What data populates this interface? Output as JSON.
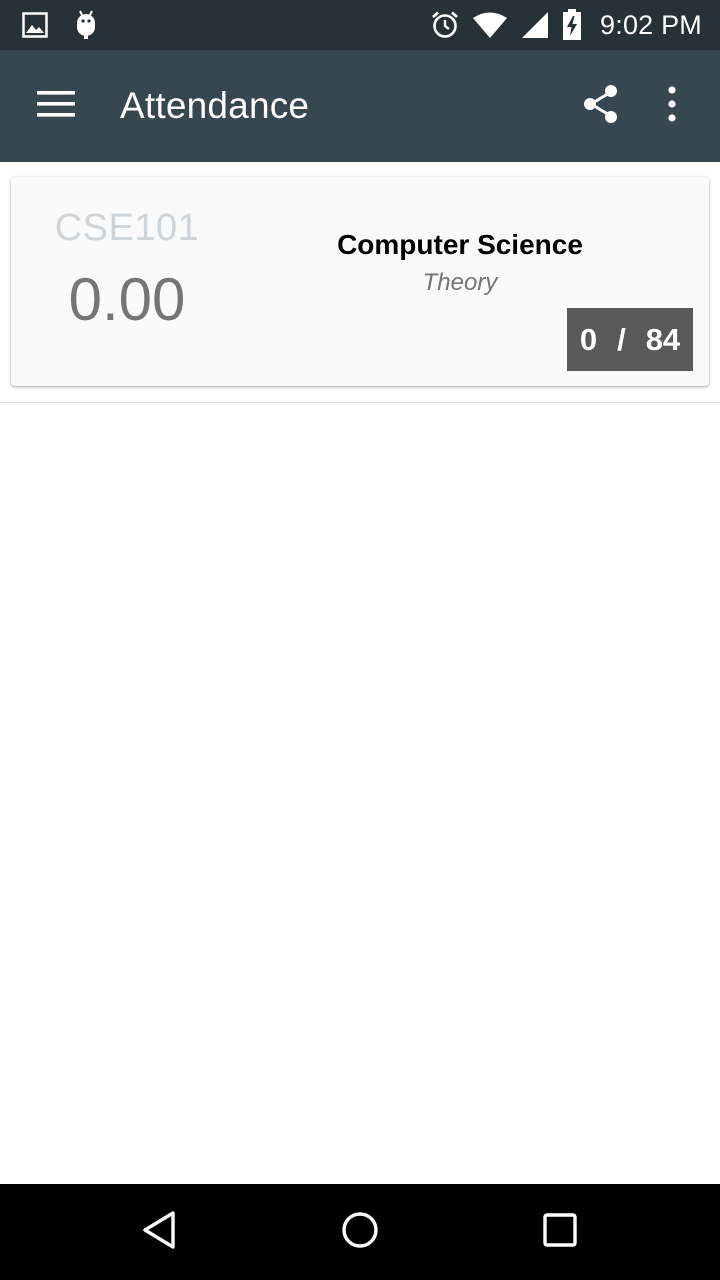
{
  "status_bar": {
    "time": "9:02 PM",
    "icons": [
      "image-icon",
      "android-icon",
      "alarm-icon",
      "wifi-icon",
      "signal-icon",
      "battery-charging-icon"
    ]
  },
  "app_bar": {
    "title": "Attendance",
    "icons": [
      "menu-icon",
      "share-icon",
      "more-vert-icon"
    ],
    "color": "#37474f"
  },
  "subjects": [
    {
      "code": "CSE101",
      "percentage": "0.00",
      "name": "Computer Science",
      "type": "Theory",
      "attended": "0",
      "separator": "/",
      "total": "84"
    }
  ],
  "nav_bar": {
    "icons": [
      "back-icon",
      "home-icon",
      "recents-icon"
    ]
  },
  "colors": {
    "status_bar": "#263238",
    "badge": "#595959"
  }
}
